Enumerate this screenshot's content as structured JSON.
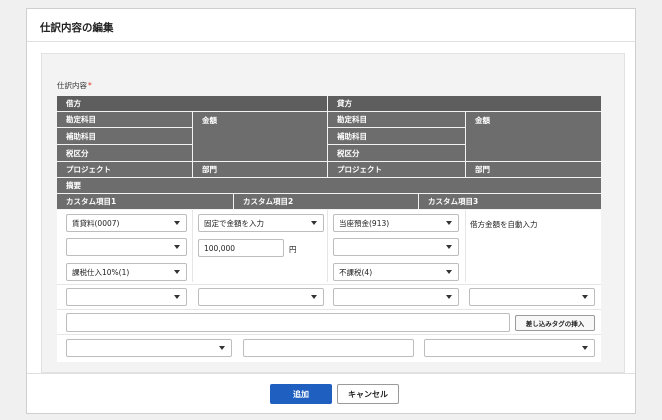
{
  "dialog": {
    "title": "仕訳内容の編集"
  },
  "section": {
    "label": "仕訳内容",
    "required_mark": "*"
  },
  "header": {
    "debit": "借方",
    "credit": "貸方",
    "account": "勘定科目",
    "amount": "金額",
    "sub_account": "補助科目",
    "tax_category": "税区分",
    "project": "プロジェクト",
    "department": "部門",
    "summary": "摘要",
    "custom1": "カスタム項目1",
    "custom2": "カスタム項目2",
    "custom3": "カスタム項目3"
  },
  "debit": {
    "account_value": "賃貸料(0007)",
    "sub_account_value": "",
    "tax_value": "課税仕入10%(1)",
    "amount_mode": "固定で金額を入力",
    "amount_value": "100,000",
    "amount_unit": "円",
    "project_value": "",
    "department_value": ""
  },
  "credit": {
    "account_value": "当座預金(913)",
    "sub_account_value": "",
    "tax_value": "不課税(4)",
    "amount_text": "借方金額を自動入力",
    "project_value": "",
    "department_value": ""
  },
  "summary": {
    "value": "",
    "insert_tag_button": "差し込みタグの挿入"
  },
  "custom": {
    "item1_value": "",
    "item2_value": "",
    "item3_value": ""
  },
  "footer": {
    "add_button": "追加",
    "cancel_button": "キャンセル"
  },
  "colors": {
    "header_bg": "#6d6d6d",
    "primary": "#1f5fbf",
    "required": "#d93025"
  }
}
